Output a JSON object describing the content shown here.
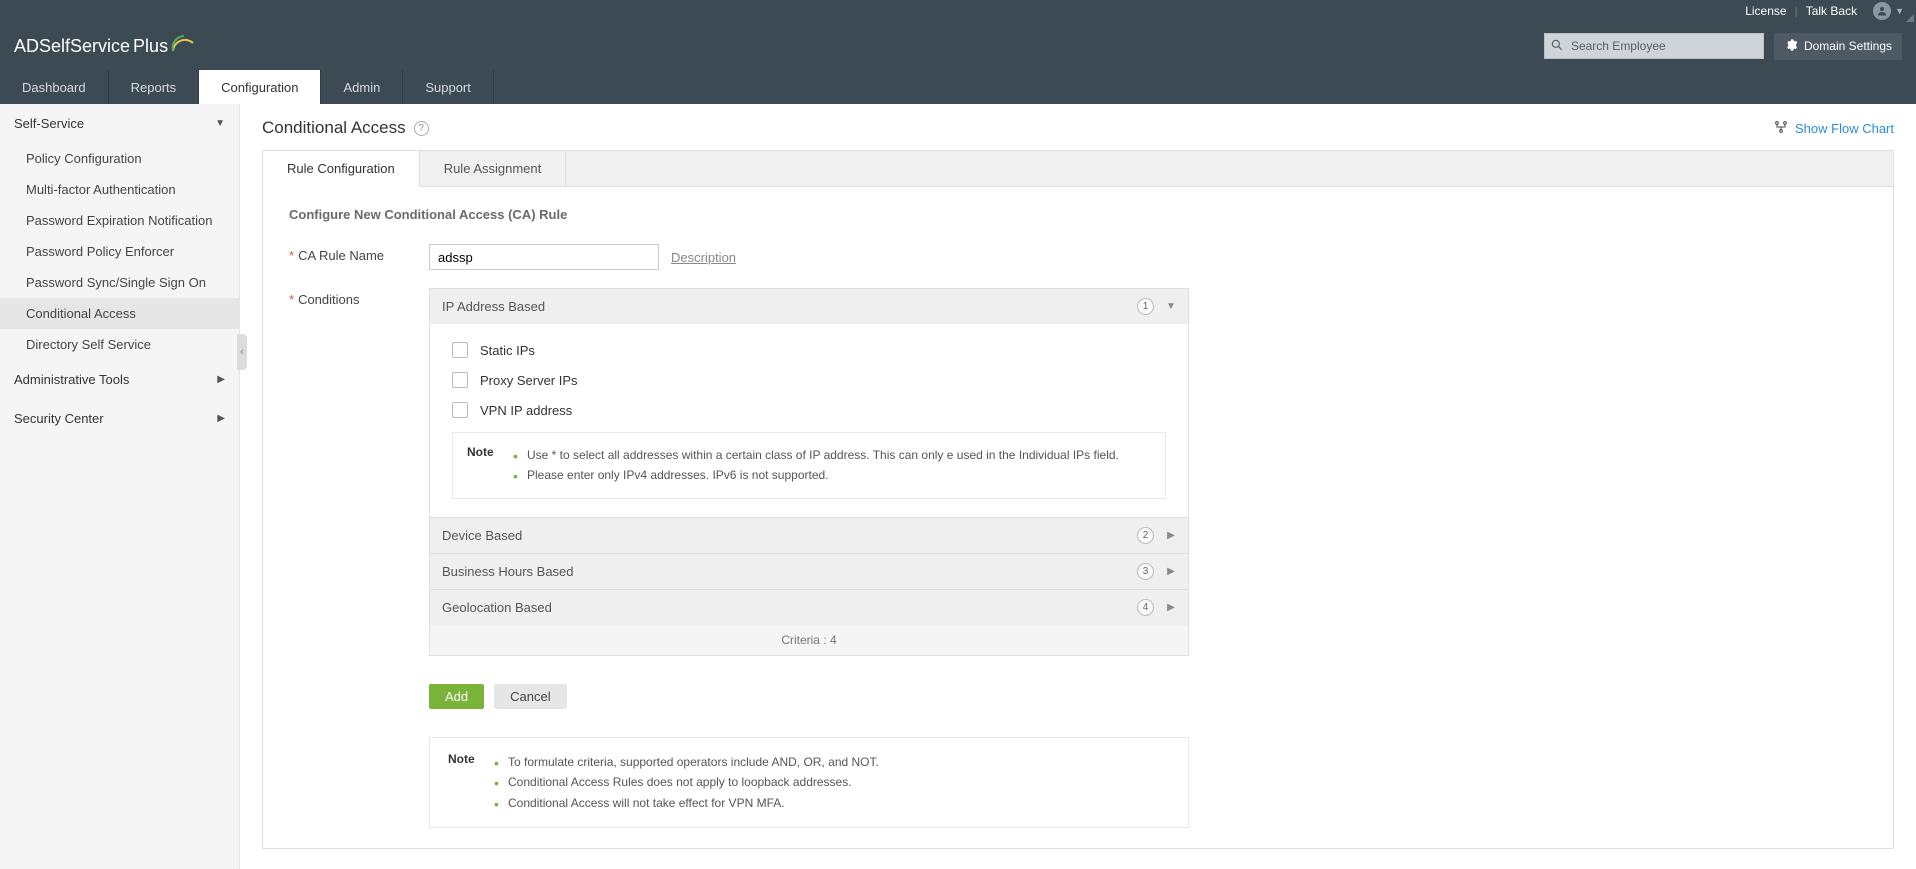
{
  "top": {
    "license": "License",
    "talkback": "Talk Back"
  },
  "logo": {
    "main": "ADSelfService",
    "suffix": "Plus"
  },
  "search": {
    "placeholder": "Search Employee"
  },
  "domain_settings": "Domain Settings",
  "nav": {
    "dashboard": "Dashboard",
    "reports": "Reports",
    "configuration": "Configuration",
    "admin": "Admin",
    "support": "Support"
  },
  "sidebar": {
    "self_service": "Self-Service",
    "items": {
      "policy": "Policy Configuration",
      "mfa": "Multi-factor Authentication",
      "pwd_exp": "Password Expiration Notification",
      "pwd_policy": "Password Policy Enforcer",
      "pwd_sync": "Password Sync/Single Sign On",
      "cond_access": "Conditional Access",
      "dir_self": "Directory Self Service"
    },
    "admin_tools": "Administrative Tools",
    "security_center": "Security Center"
  },
  "page": {
    "title": "Conditional Access",
    "flow_link": "Show Flow Chart"
  },
  "tabs": {
    "rule_config": "Rule Configuration",
    "rule_assign": "Rule Assignment"
  },
  "form": {
    "section_title": "Configure New Conditional Access (CA) Rule",
    "rule_name_label": "CA Rule Name",
    "rule_name_value": "adssp",
    "description_link": "Description",
    "conditions_label": "Conditions",
    "conditions": {
      "ip": "IP Address Based",
      "ip_badge": "1",
      "static_ips": "Static IPs",
      "proxy_ips": "Proxy Server IPs",
      "vpn_ip": "VPN IP address",
      "note_label": "Note",
      "note1": "Use * to select all addresses within a certain class of IP address. This can only e used in the Individual IPs field.",
      "note2": "Please enter only IPv4 addresses. IPv6 is not supported.",
      "device": "Device Based",
      "device_badge": "2",
      "hours": "Business Hours Based",
      "hours_badge": "3",
      "geo": "Geolocation Based",
      "geo_badge": "4",
      "criteria_footer_label": "Criteria",
      "criteria_footer_value": "4"
    },
    "add_btn": "Add",
    "cancel_btn": "Cancel",
    "bottom_note_label": "Note",
    "bottom_note1": "To formulate criteria, supported operators include AND, OR, and NOT.",
    "bottom_note2": "Conditional Access Rules does not apply to loopback addresses.",
    "bottom_note3": "Conditional Access will not take effect for VPN MFA."
  }
}
